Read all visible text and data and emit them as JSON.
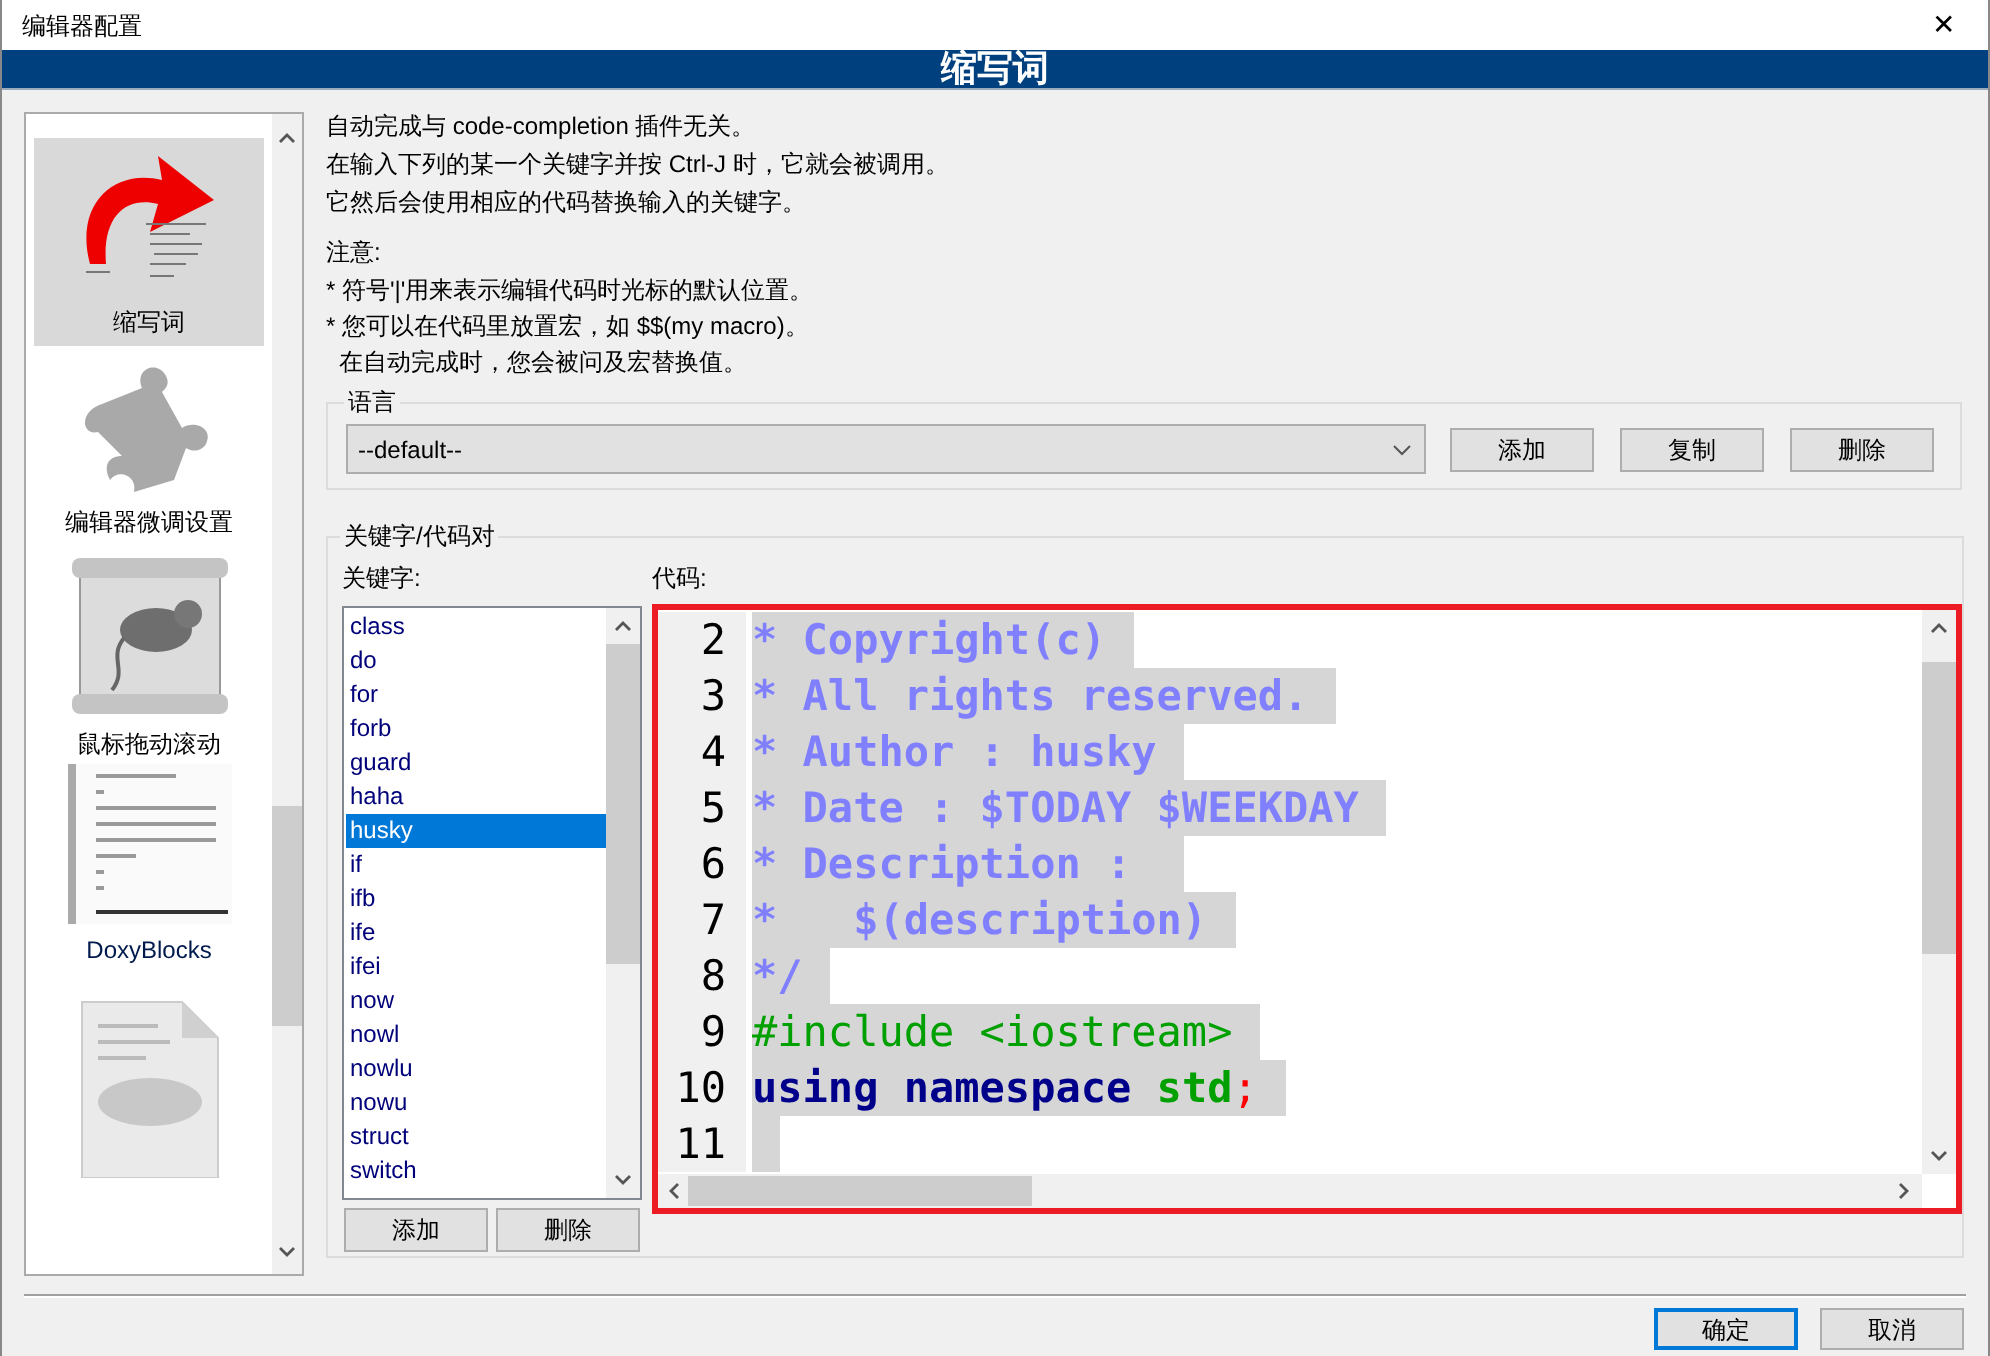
{
  "window": {
    "title": "编辑器配置",
    "close": "✕"
  },
  "header": {
    "title": "缩写词"
  },
  "sidebar": {
    "items": [
      {
        "label": "缩写词",
        "selected": true
      },
      {
        "label": "编辑器微调设置",
        "selected": false
      },
      {
        "label": "鼠标拖动滚动",
        "selected": false
      },
      {
        "label": "DoxyBlocks",
        "selected": false
      },
      {
        "selected": false
      }
    ]
  },
  "intro": [
    "自动完成与 code-completion 插件无关。",
    "在输入下列的某一个关键字并按 Ctrl-J 时，它就会被调用。",
    "它然后会使用相应的代码替换输入的关键字。"
  ],
  "notes_heading": "注意:",
  "notes": [
    "* 符号'|'用来表示编辑代码时光标的默认位置。",
    "* 您可以在代码里放置宏，如 $$(my macro)。",
    "  在自动完成时，您会被问及宏替换值。"
  ],
  "language": {
    "title": "语言",
    "value": "--default--",
    "buttons": [
      "添加",
      "复制",
      "删除"
    ]
  },
  "pairs": {
    "title": "关键字/代码对",
    "keywords_label": "关键字:",
    "keywords": [
      {
        "label": "class",
        "selected": false
      },
      {
        "label": "do",
        "selected": false
      },
      {
        "label": "for",
        "selected": false
      },
      {
        "label": "forb",
        "selected": false
      },
      {
        "label": "guard",
        "selected": false
      },
      {
        "label": "haha",
        "selected": false
      },
      {
        "label": "husky",
        "selected": true
      },
      {
        "label": "if",
        "selected": false
      },
      {
        "label": "ifb",
        "selected": false
      },
      {
        "label": "ife",
        "selected": false
      },
      {
        "label": "ifei",
        "selected": false
      },
      {
        "label": "now",
        "selected": false
      },
      {
        "label": "nowl",
        "selected": false
      },
      {
        "label": "nowlu",
        "selected": false
      },
      {
        "label": "nowu",
        "selected": false
      },
      {
        "label": "struct",
        "selected": false
      },
      {
        "label": "switch",
        "selected": false
      }
    ],
    "buttons": [
      "添加",
      "删除"
    ],
    "code_label": "代码:",
    "code": {
      "lines": [
        {
          "number": "2",
          "tokens": [
            {
              "kind": "comment",
              "text": "* Copyright(c)"
            }
          ]
        },
        {
          "number": "3",
          "tokens": [
            {
              "kind": "comment",
              "text": "* All rights reserved."
            }
          ]
        },
        {
          "number": "4",
          "tokens": [
            {
              "kind": "comment",
              "text": "* Author : husky"
            }
          ]
        },
        {
          "number": "5",
          "tokens": [
            {
              "kind": "comment",
              "text": "* Date : $TODAY $WEEKDAY"
            }
          ]
        },
        {
          "number": "6",
          "tokens": [
            {
              "kind": "comment",
              "text": "* Description : "
            }
          ]
        },
        {
          "number": "7",
          "tokens": [
            {
              "kind": "comment",
              "text": "*   $(description)"
            }
          ]
        },
        {
          "number": "8",
          "tokens": [
            {
              "kind": "comment",
              "text": "*/"
            }
          ]
        },
        {
          "number": "9",
          "tokens": [
            {
              "kind": "preprocessor",
              "text": "#include <iostream>"
            }
          ]
        },
        {
          "number": "10",
          "tokens": [
            {
              "kind": "keyword",
              "text": "using namespace "
            },
            {
              "kind": "identifier",
              "text": "std"
            },
            {
              "kind": "operator",
              "text": ";"
            }
          ]
        },
        {
          "number": "11"
        }
      ]
    }
  },
  "footer": {
    "buttons": [
      {
        "label": "确定",
        "default": true
      },
      {
        "label": "取消",
        "default": false
      }
    ]
  }
}
